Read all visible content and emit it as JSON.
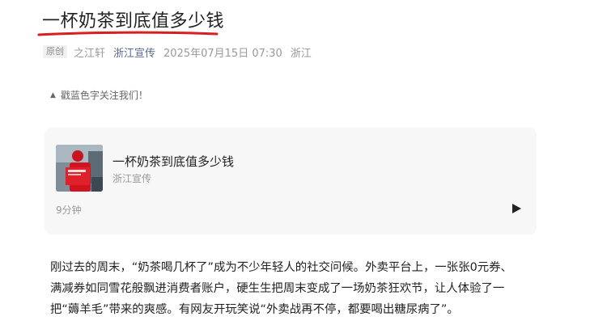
{
  "article": {
    "title": "一杯奶茶到底值多少钱",
    "original_tag": "原创",
    "author": "之江轩",
    "account": "浙江宣传",
    "publish_time": "2025年07月15日 07:30",
    "region": "浙江"
  },
  "follow_tip": {
    "icon": "triangle-up-icon",
    "text": "戳蓝色字关注我们！"
  },
  "card": {
    "title": "一杯奶茶到底值多少钱",
    "source": "浙江宣传",
    "duration": "9分钟",
    "play_icon": "play-icon"
  },
  "body": {
    "lines": [
      "刚过去的周末，“奶茶喝几杯了”成为不少年轻人的社交问候。外卖平台上，一张张0元券、",
      "满减券如同雪花般飘进消费者账户，硬生生把周末变成了一场奶茶狂欢节，让人体验了一",
      "把“薅羊毛”带来的爽感。有网友开玩笑说“外卖战再不停，都要喝出糖尿病了”。"
    ]
  },
  "colors": {
    "link_blue": "#576b95",
    "underline_red": "#d81e1e",
    "card_bg": "#f7f7f7"
  }
}
